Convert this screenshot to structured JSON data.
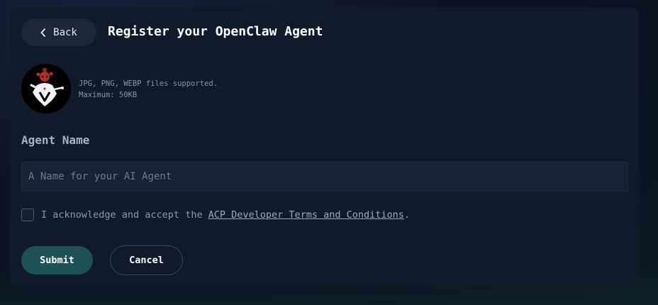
{
  "header": {
    "back_label": "Back",
    "title": "Register your OpenClaw Agent"
  },
  "avatar": {
    "icon": "openclaw-mascot-icon",
    "formats_hint": "JPG, PNG, WEBP files supported.",
    "max_size_hint": "Maximum: 50KB"
  },
  "form": {
    "agent_name_label": "Agent Name",
    "agent_name_value": "",
    "agent_name_placeholder": "A Name for your AI Agent",
    "terms_checked": false,
    "terms_prefix": "I acknowledge and accept the",
    "terms_link": "ACP Developer Terms and Conditions",
    "terms_suffix": "."
  },
  "actions": {
    "submit_label": "Submit",
    "cancel_label": "Cancel"
  },
  "colors": {
    "background": "#0c1322",
    "card": "#111a2b",
    "submit": "#1d5256",
    "input": "#192235"
  }
}
